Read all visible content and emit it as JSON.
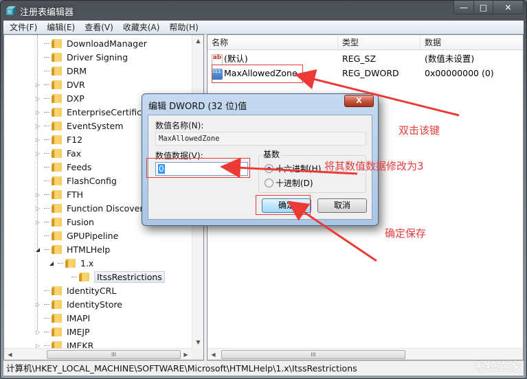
{
  "window": {
    "title": "注册表编辑器",
    "caption_buttons": {
      "minimize": "—",
      "maximize": "□",
      "close": "✕"
    }
  },
  "menu": [
    {
      "label": "文件(F)"
    },
    {
      "label": "编辑(E)"
    },
    {
      "label": "查看(V)"
    },
    {
      "label": "收藏夹(A)"
    },
    {
      "label": "帮助(H)"
    }
  ],
  "tree": {
    "items": [
      {
        "label": "DownloadManager",
        "expander": ""
      },
      {
        "label": "Driver Signing",
        "expander": ""
      },
      {
        "label": "DRM",
        "expander": ""
      },
      {
        "label": "DVR",
        "expander": "▷"
      },
      {
        "label": "DXP",
        "expander": "▷"
      },
      {
        "label": "EnterpriseCertificates",
        "expander": "▷"
      },
      {
        "label": "EventSystem",
        "expander": "▷"
      },
      {
        "label": "F12",
        "expander": "▷"
      },
      {
        "label": "Fax",
        "expander": "▷"
      },
      {
        "label": "Feeds",
        "expander": ""
      },
      {
        "label": "FlashConfig",
        "expander": ""
      },
      {
        "label": "FTH",
        "expander": "▷"
      },
      {
        "label": "Function Discovery",
        "expander": "▷"
      },
      {
        "label": "Fusion",
        "expander": "▷"
      },
      {
        "label": "GPUPipeline",
        "expander": ""
      },
      {
        "label": "HTMLHelp",
        "expander": "◢"
      },
      {
        "label": "1.x",
        "expander": "◢"
      },
      {
        "label": "ItssRestrictions",
        "expander": ""
      },
      {
        "label": "IdentityCRL",
        "expander": ""
      },
      {
        "label": "IdentityStore",
        "expander": "▷"
      },
      {
        "label": "IMAPI",
        "expander": ""
      },
      {
        "label": "IMEJP",
        "expander": "▷"
      },
      {
        "label": "IMEKR",
        "expander": "▷"
      }
    ],
    "scroll_up": "▲",
    "scroll_down": "▼",
    "scroll_left": "◀",
    "scroll_right": "▶",
    "thumb_grip": "III"
  },
  "list": {
    "columns": [
      "名称",
      "类型",
      "数据"
    ],
    "rows": [
      {
        "name": "(默认)",
        "type": "REG_SZ",
        "data": "(数值未设置)",
        "icon": "ab"
      },
      {
        "name": "MaxAllowedZone",
        "type": "REG_DWORD",
        "data": "0x00000000 (0)",
        "icon": "011 110"
      }
    ]
  },
  "statusbar": {
    "path": "计算机\\HKEY_LOCAL_MACHINE\\SOFTWARE\\Microsoft\\HTMLHelp\\1.x\\ItssRestrictions"
  },
  "dialog": {
    "title": "编辑 DWORD (32 位)值",
    "close_label": "X",
    "name_label": "数值名称(N):",
    "name_value": "MaxAllowedZone",
    "data_label": "数值数据(V):",
    "data_value": "0",
    "base_label": "基数",
    "radio_hex": "十六进制(H)",
    "radio_dec": "十进制(D)",
    "base_selected": "hex",
    "ok_label": "确定",
    "cancel_label": "取消"
  },
  "annotations": {
    "double_click": "双击该键",
    "modify_value": "将其数值数据修改为3",
    "confirm_save": "确定保存",
    "color": "#e53b3b"
  },
  "watermark": "系统之家"
}
